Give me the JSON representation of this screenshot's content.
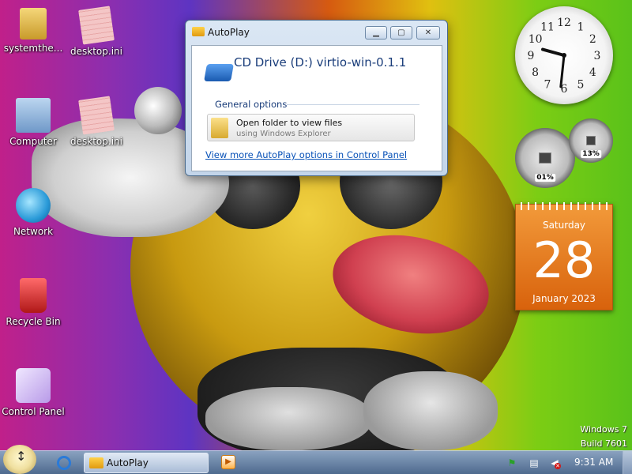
{
  "desktop": {
    "icons": [
      {
        "label": "systemthe...",
        "icon": "folder-icon"
      },
      {
        "label": "desktop.ini",
        "icon": "ini-file-icon"
      },
      {
        "label": "Computer",
        "icon": "computer-icon"
      },
      {
        "label": "desktop.ini",
        "icon": "ini-file-icon"
      },
      {
        "label": "Network",
        "icon": "network-icon"
      },
      {
        "label": "Recycle Bin",
        "icon": "recycle-bin-icon"
      },
      {
        "label": "Control Panel",
        "icon": "control-panel-icon"
      }
    ],
    "watermark_line1": "Windows 7",
    "watermark_line2": "Build 7601"
  },
  "autoplay": {
    "title": "AutoPlay",
    "drive_title": "CD Drive (D:) virtio-win-0.1.1",
    "group_title": "General options",
    "option_main": "Open folder to view files",
    "option_sub": "using Windows Explorer",
    "link": "View more AutoPlay options in Control Panel"
  },
  "gadgets": {
    "clock": {
      "hour": 9,
      "minute": 31,
      "numbers": [
        "12",
        "1",
        "2",
        "3",
        "4",
        "5",
        "6",
        "7",
        "8",
        "9",
        "10",
        "11"
      ]
    },
    "cpu_meter": {
      "cpu": "01%",
      "memory": "13%"
    },
    "calendar": {
      "day_name": "Saturday",
      "date": "28",
      "month_year": "January 2023"
    }
  },
  "taskbar": {
    "task_label": "AutoPlay",
    "time": "9:31 AM"
  },
  "colors": {
    "calendar": "#e0741c",
    "link": "#0a53b8",
    "drive_title": "#1a3d7a"
  }
}
